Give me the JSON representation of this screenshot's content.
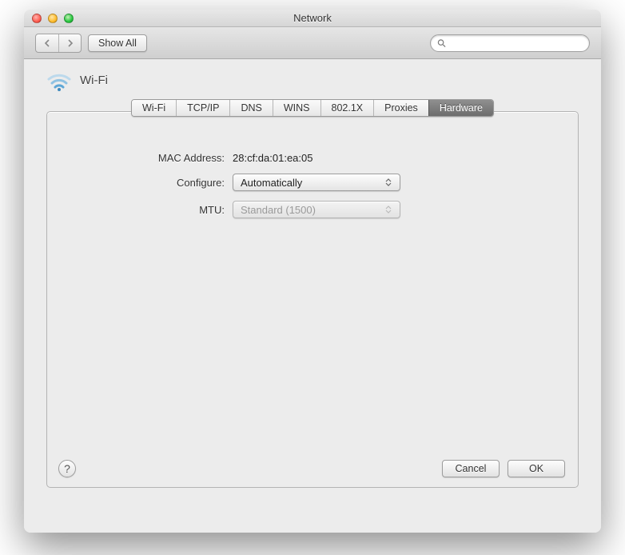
{
  "window": {
    "title": "Network"
  },
  "toolbar": {
    "show_all_label": "Show All",
    "search_placeholder": ""
  },
  "interface": {
    "name": "Wi-Fi"
  },
  "tabs": [
    {
      "label": "Wi-Fi"
    },
    {
      "label": "TCP/IP"
    },
    {
      "label": "DNS"
    },
    {
      "label": "WINS"
    },
    {
      "label": "802.1X"
    },
    {
      "label": "Proxies"
    },
    {
      "label": "Hardware",
      "selected": true
    }
  ],
  "form": {
    "mac_label": "MAC Address:",
    "mac_value": "28:cf:da:01:ea:05",
    "configure_label": "Configure:",
    "configure_value": "Automatically",
    "mtu_label": "MTU:",
    "mtu_value": "Standard (1500)",
    "mtu_disabled": true
  },
  "buttons": {
    "help": "?",
    "cancel": "Cancel",
    "ok": "OK"
  }
}
